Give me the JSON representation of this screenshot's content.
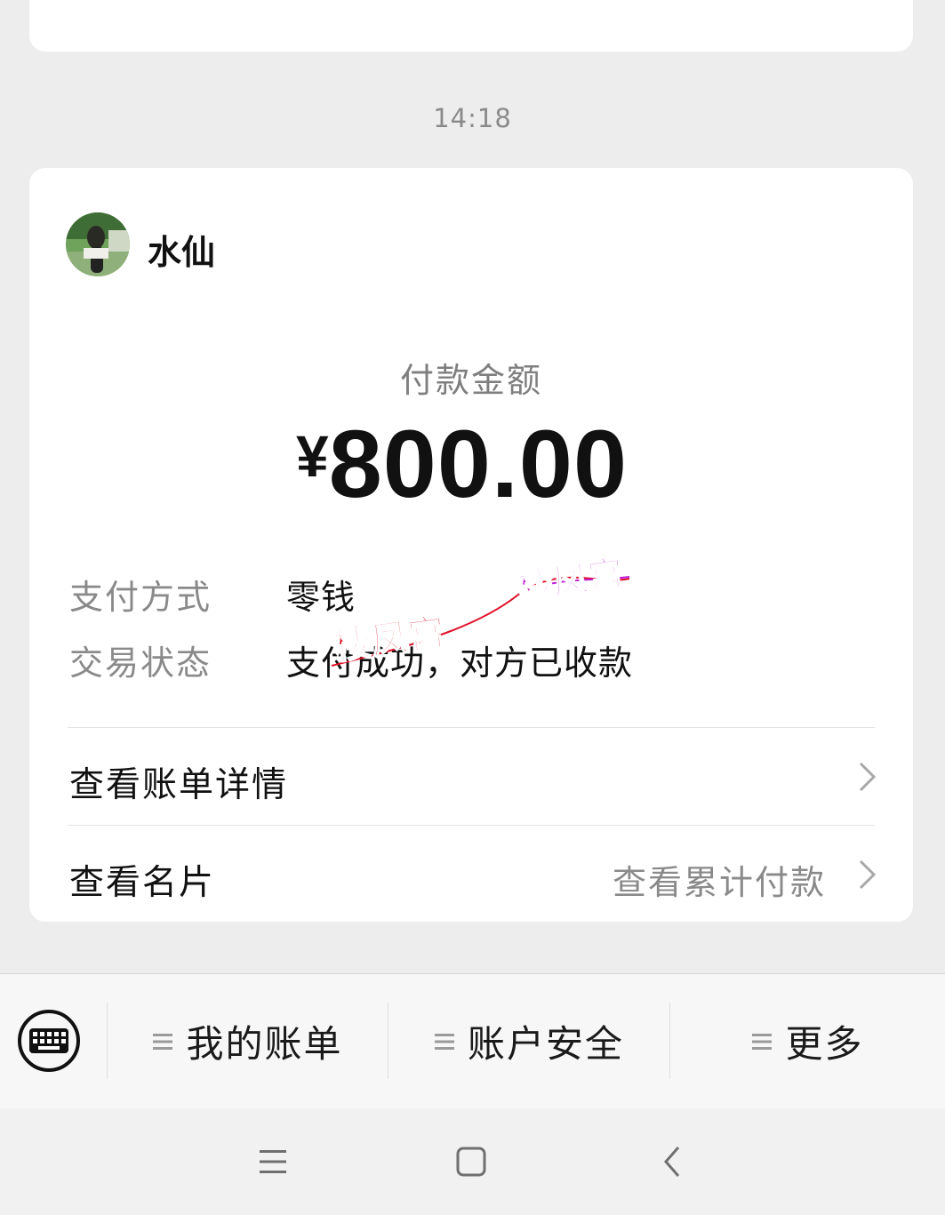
{
  "chat": {
    "timestamp": "14:18"
  },
  "payment_card": {
    "sender_name": "水仙",
    "amount_label": "付款金额",
    "currency_symbol": "¥",
    "amount": "800.00",
    "details": [
      {
        "label": "支付方式",
        "value": "零钱"
      },
      {
        "label": "交易状态",
        "value": "支付成功，对方已收款"
      }
    ],
    "view_bill_label": "查看账单详情",
    "view_card_label": "查看名片",
    "cumulative_payment_label": "查看累计付款"
  },
  "watermark": {
    "text": "楼凤宫"
  },
  "bottom_menu": {
    "items": [
      {
        "label": "我的账单",
        "icon": "menu-lines-icon"
      },
      {
        "label": "账户安全",
        "icon": "menu-lines-icon"
      },
      {
        "label": "更多",
        "icon": "menu-lines-icon"
      }
    ]
  },
  "nav_bar": {
    "icons": [
      "menu-icon",
      "home-icon",
      "back-icon"
    ]
  },
  "colors": {
    "background": "#ededed",
    "card": "#ffffff",
    "muted_text": "#8a8a8a",
    "watermark_red": "#e0102a",
    "watermark_magenta": "#c21fd6"
  }
}
